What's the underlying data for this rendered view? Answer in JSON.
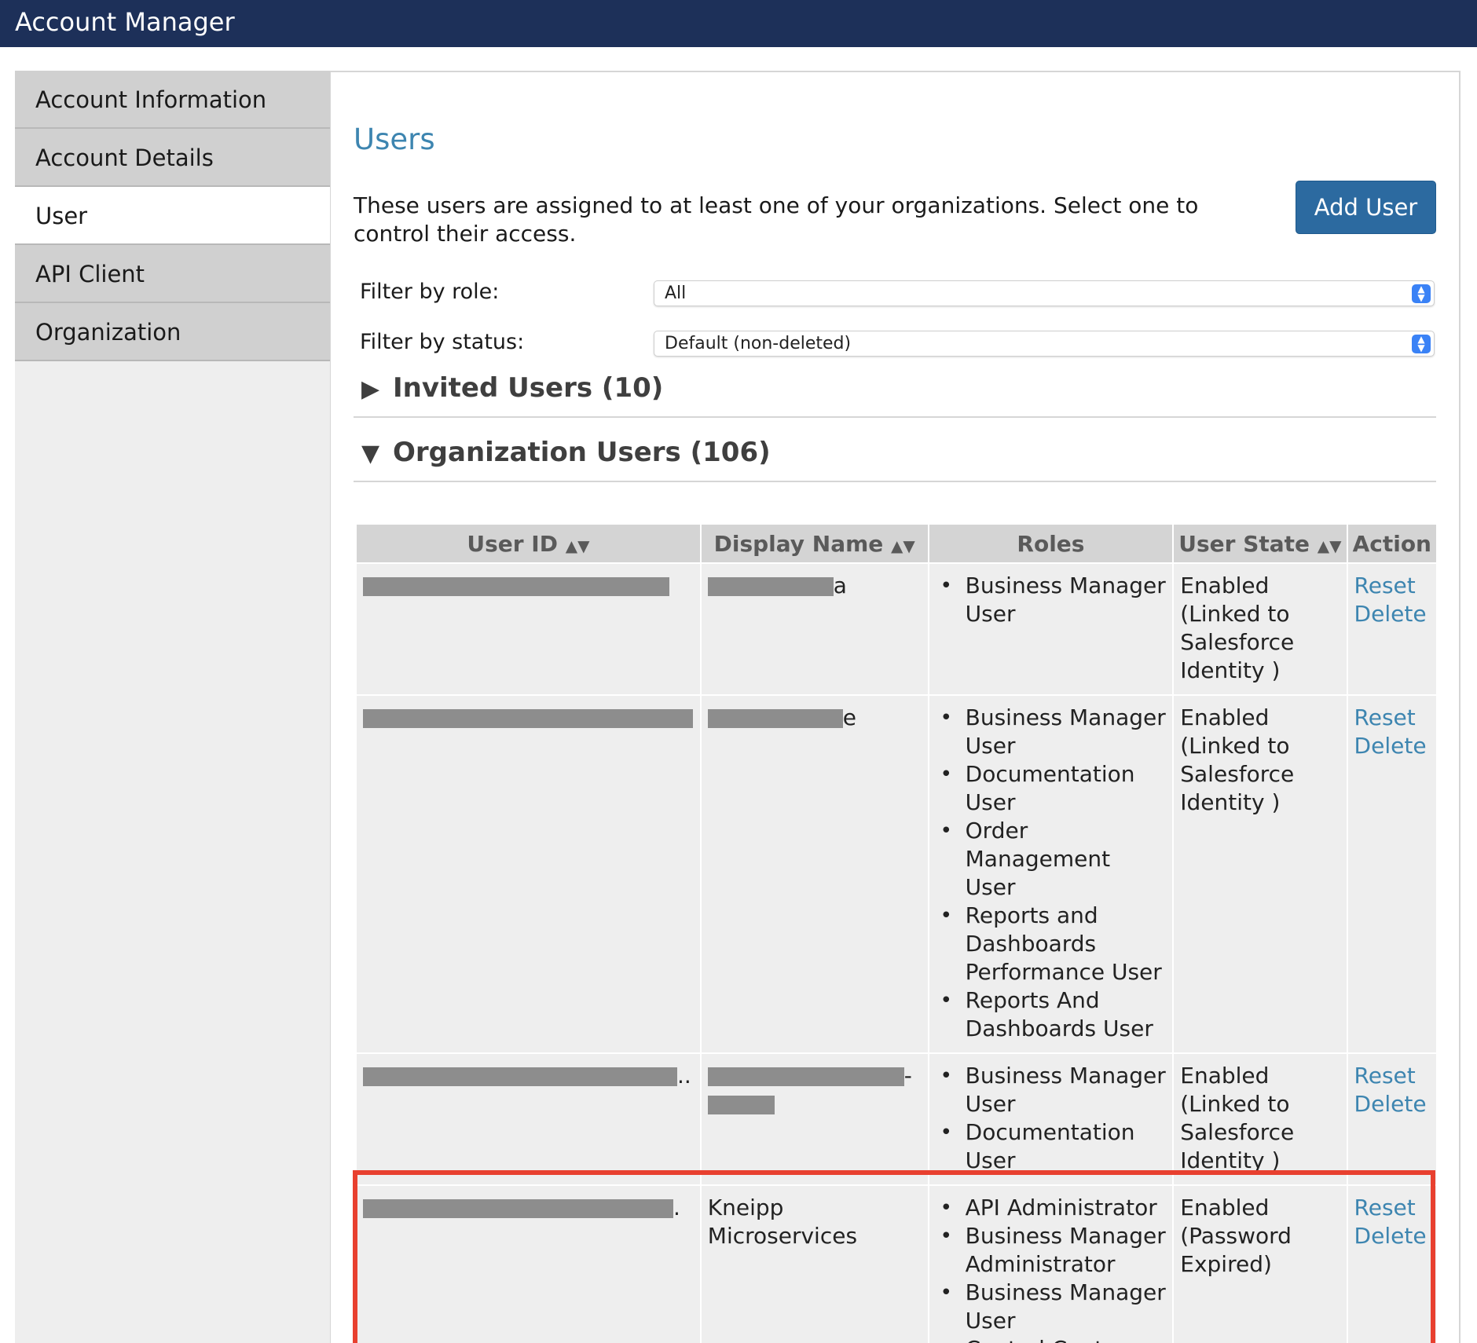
{
  "app": {
    "title": "Account Manager"
  },
  "sidebar": {
    "items": [
      {
        "label": "Account Information",
        "active": false
      },
      {
        "label": "Account Details",
        "active": false
      },
      {
        "label": "User",
        "active": true
      },
      {
        "label": "API Client",
        "active": false
      },
      {
        "label": "Organization",
        "active": false
      }
    ]
  },
  "main": {
    "title": "Users",
    "description": "These users are assigned to at least one of your organizations. Select one to control their access.",
    "add_user_label": "Add User",
    "filters": {
      "role_label": "Filter by role:",
      "role_value": "All",
      "status_label": "Filter by status:",
      "status_value": "Default (non-deleted)"
    },
    "invited_section": "Invited Users (10)",
    "org_section": "Organization Users (106)"
  },
  "table": {
    "headers": {
      "user_id": "User ID",
      "display_name": "Display Name",
      "roles": "Roles",
      "user_state": "User State",
      "action": "Action"
    },
    "rows": [
      {
        "user_id_tail": "",
        "display_name_tail": "a",
        "roles": [
          "Business Manager User"
        ],
        "state": "Enabled (Linked to Salesforce Identity )",
        "reset": "Reset",
        "delete": "Delete"
      },
      {
        "user_id_tail": "",
        "display_name_tail": "e",
        "roles": [
          "Business Manager User",
          "Documentation User",
          "Order Management User",
          "Reports and Dashboards Performance User",
          "Reports And Dashboards User"
        ],
        "state": "Enabled (Linked to Salesforce Identity )",
        "reset": "Reset",
        "delete": "Delete"
      },
      {
        "user_id_tail": "..",
        "display_name_tail": "-",
        "roles": [
          "Business Manager User",
          "Documentation User"
        ],
        "state": "Enabled (Linked to Salesforce Identity )",
        "reset": "Reset",
        "delete": "Delete"
      },
      {
        "user_id_tail": ".",
        "display_name": "Kneipp Microservices",
        "roles": [
          "API Administrator",
          "Business Manager Administrator",
          "Business Manager User",
          "Control Center"
        ],
        "state": "Enabled (Password Expired)",
        "reset": "Reset",
        "delete": "Delete"
      }
    ]
  },
  "colors": {
    "topbar": "#1d3059",
    "accent": "#3d85b0",
    "button": "#2c6aa0",
    "highlight": "#e8402f"
  }
}
